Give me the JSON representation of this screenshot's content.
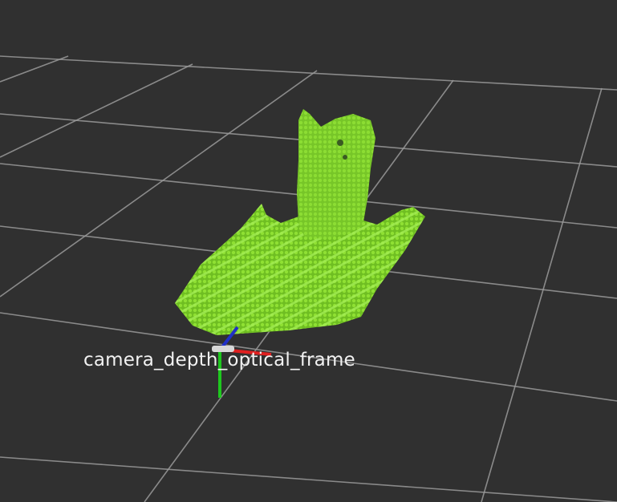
{
  "viewport": {
    "background_color": "#303030",
    "grid_color": "#9a9a9a",
    "point_cloud_color": "#7cd42a"
  },
  "tf_frame": {
    "label": "camera_depth_optical_frame",
    "axes": {
      "x_color": "#e02020",
      "y_color": "#1ec81e",
      "z_color": "#2030c8"
    }
  }
}
